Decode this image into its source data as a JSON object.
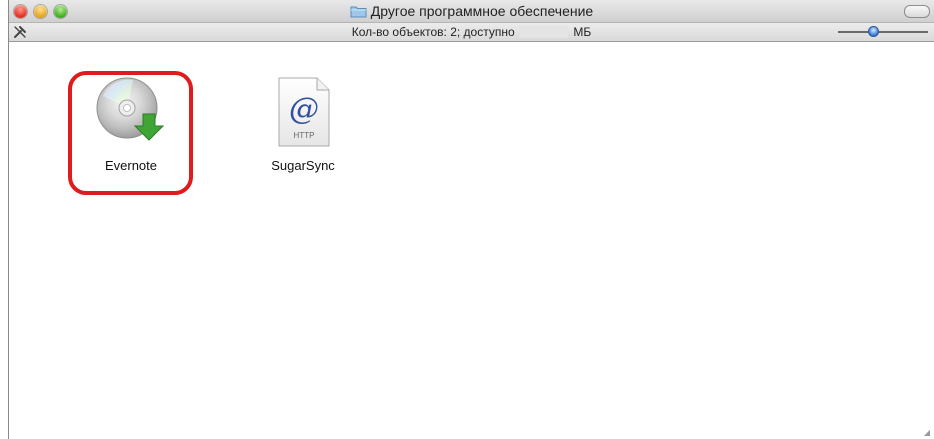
{
  "window": {
    "title": "Другое программное обеспечение"
  },
  "statusbar": {
    "text_before": "Кол-во объектов: 2; доступно",
    "text_after": "МБ"
  },
  "icon_size_slider": {
    "level_fraction": 0.38
  },
  "items": [
    {
      "label": "Evernote",
      "icon": "install-disc-icon",
      "highlighted": true
    },
    {
      "label": "SugarSync",
      "icon": "http-link-icon",
      "highlighted": false
    }
  ],
  "colors": {
    "highlight": "#e01b1b",
    "disc_arrow": "#3fa535",
    "at_sign": "#2f4fa0"
  }
}
